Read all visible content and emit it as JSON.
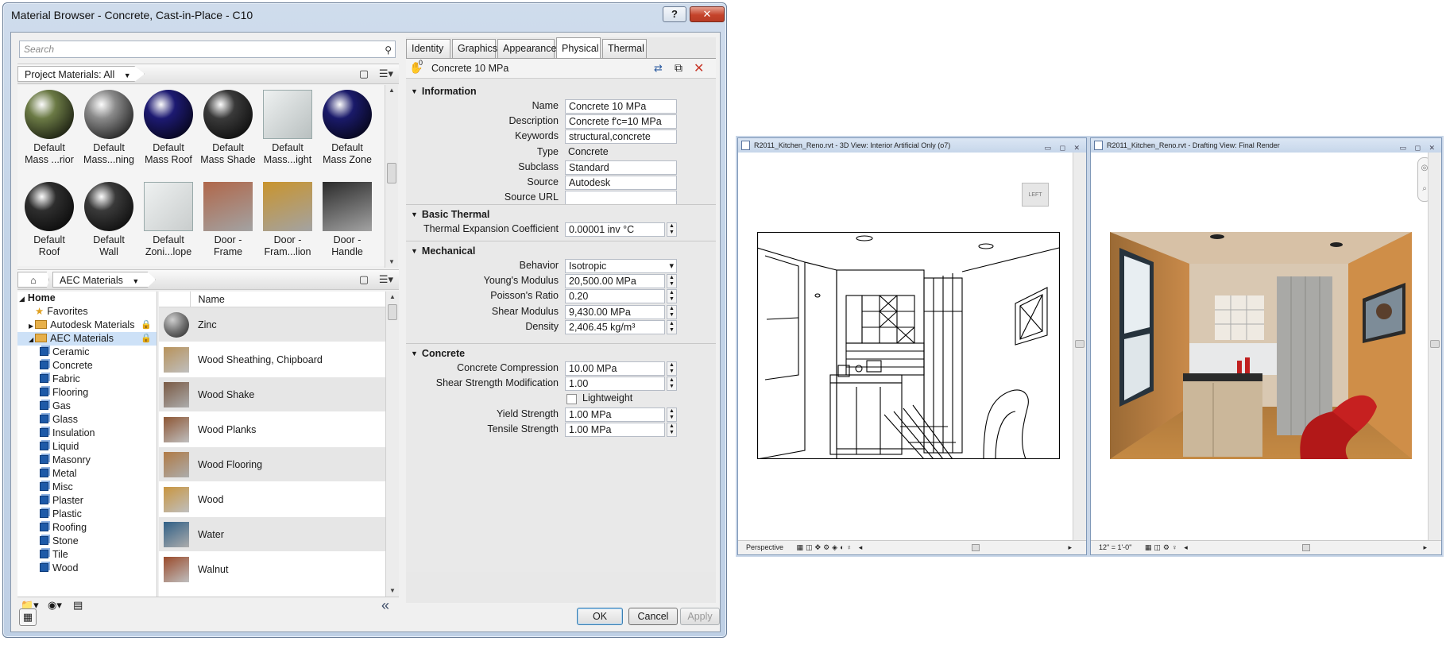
{
  "dialog": {
    "title": "Material Browser - Concrete, Cast-in-Place - C10",
    "help_label": "?",
    "close_label": "✕"
  },
  "browser": {
    "search_placeholder": "Search",
    "filter_label": "Project Materials: All",
    "swatches": [
      {
        "label1": "Default",
        "label2": "Mass ...rior",
        "color": "#6b7a45",
        "kind": "sphere"
      },
      {
        "label1": "Default",
        "label2": "Mass...ning",
        "color": "#8a8a8a",
        "kind": "sphere"
      },
      {
        "label1": "Default",
        "label2": "Mass Roof",
        "color": "#1d1a72",
        "kind": "sphere"
      },
      {
        "label1": "Default",
        "label2": "Mass Shade",
        "color": "#3a3a3a",
        "kind": "sphere"
      },
      {
        "label1": "Default",
        "label2": "Mass...ight",
        "color": "#b9c0c0",
        "kind": "glass"
      },
      {
        "label1": "Default",
        "label2": "Mass Zone",
        "color": "#1a1a6a",
        "kind": "sphere"
      },
      {
        "label1": "Default",
        "label2": "Roof",
        "color": "#2e2e2e",
        "kind": "sphere"
      },
      {
        "label1": "Default",
        "label2": "Wall",
        "color": "#3a3a3a",
        "kind": "sphere"
      },
      {
        "label1": "Default",
        "label2": "Zoni...lope",
        "color": "#c9cdcd",
        "kind": "glass"
      },
      {
        "label1": "Door -",
        "label2": "Frame",
        "color": "#b0674a",
        "kind": "box"
      },
      {
        "label1": "Door -",
        "label2": "Fram...lion",
        "color": "#c9942d",
        "kind": "box"
      },
      {
        "label1": "Door -",
        "label2": "Handle",
        "color": "#2b2b2b",
        "kind": "box"
      }
    ],
    "breadcrumb_library": "AEC Materials",
    "tree": [
      {
        "label": "Home",
        "level": 0,
        "kind": "root",
        "bold": true
      },
      {
        "label": "Favorites",
        "level": 1,
        "kind": "star"
      },
      {
        "label": "Autodesk Materials",
        "level": 1,
        "kind": "folder",
        "locked": true,
        "expander": "▶"
      },
      {
        "label": "AEC Materials",
        "level": 1,
        "kind": "folder",
        "locked": true,
        "expander": "◢",
        "selected": true
      },
      {
        "label": "Ceramic",
        "level": 2,
        "kind": "lib"
      },
      {
        "label": "Concrete",
        "level": 2,
        "kind": "lib"
      },
      {
        "label": "Fabric",
        "level": 2,
        "kind": "lib"
      },
      {
        "label": "Flooring",
        "level": 2,
        "kind": "lib"
      },
      {
        "label": "Gas",
        "level": 2,
        "kind": "lib"
      },
      {
        "label": "Glass",
        "level": 2,
        "kind": "lib"
      },
      {
        "label": "Insulation",
        "level": 2,
        "kind": "lib"
      },
      {
        "label": "Liquid",
        "level": 2,
        "kind": "lib"
      },
      {
        "label": "Masonry",
        "level": 2,
        "kind": "lib"
      },
      {
        "label": "Metal",
        "level": 2,
        "kind": "lib"
      },
      {
        "label": "Misc",
        "level": 2,
        "kind": "lib"
      },
      {
        "label": "Plaster",
        "level": 2,
        "kind": "lib"
      },
      {
        "label": "Plastic",
        "level": 2,
        "kind": "lib"
      },
      {
        "label": "Roofing",
        "level": 2,
        "kind": "lib"
      },
      {
        "label": "Stone",
        "level": 2,
        "kind": "lib"
      },
      {
        "label": "Tile",
        "level": 2,
        "kind": "lib"
      },
      {
        "label": "Wood",
        "level": 2,
        "kind": "lib"
      }
    ],
    "list_header": "Name",
    "materials": [
      {
        "name": "Zinc",
        "color": "#6f6f6f",
        "sphere": true
      },
      {
        "name": "Wood Sheathing, Chipboard",
        "color": "#b8925a"
      },
      {
        "name": "Wood Shake",
        "color": "#7a5a44"
      },
      {
        "name": "Wood Planks",
        "color": "#8d5634"
      },
      {
        "name": "Wood Flooring",
        "color": "#b07a45"
      },
      {
        "name": "Wood",
        "color": "#c9953f"
      },
      {
        "name": "Water",
        "color": "#2f5f86"
      },
      {
        "name": "Walnut",
        "color": "#9a4a2a"
      }
    ],
    "collapse_label": "«"
  },
  "editor": {
    "tabs": [
      "Identity",
      "Graphics",
      "Appearance",
      "Physical",
      "Thermal"
    ],
    "active_tab": "Physical",
    "asset_name": "Concrete 10 MPa",
    "asset_users": "0",
    "sections": {
      "information": {
        "title": "Information",
        "fields": [
          {
            "label": "Name",
            "value": "Concrete 10 MPa",
            "kind": "text"
          },
          {
            "label": "Description",
            "value": "Concrete f'c=10 MPa",
            "kind": "text"
          },
          {
            "label": "Keywords",
            "value": "structural,concrete",
            "kind": "text"
          },
          {
            "label": "Type",
            "value": "Concrete",
            "kind": "plain"
          },
          {
            "label": "Subclass",
            "value": "Standard",
            "kind": "text"
          },
          {
            "label": "Source",
            "value": "Autodesk",
            "kind": "text"
          },
          {
            "label": "Source URL",
            "value": "",
            "kind": "text"
          }
        ]
      },
      "basic_thermal": {
        "title": "Basic Thermal",
        "fields": [
          {
            "label": "Thermal Expansion Coefficient",
            "value": "0.00001 inv °C",
            "kind": "spin"
          }
        ]
      },
      "mechanical": {
        "title": "Mechanical",
        "fields": [
          {
            "label": "Behavior",
            "value": "Isotropic",
            "kind": "combo"
          },
          {
            "label": "Young's Modulus",
            "value": "20,500.00 MPa",
            "kind": "spin"
          },
          {
            "label": "Poisson's Ratio",
            "value": "0.20",
            "kind": "spin"
          },
          {
            "label": "Shear Modulus",
            "value": "9,430.00 MPa",
            "kind": "spin"
          },
          {
            "label": "Density",
            "value": "2,406.45 kg/m³",
            "kind": "spin"
          }
        ]
      },
      "concrete": {
        "title": "Concrete",
        "fields": [
          {
            "label": "Concrete Compression",
            "value": "10.00 MPa",
            "kind": "spin"
          },
          {
            "label": "Shear Strength Modification",
            "value": "1.00",
            "kind": "spin"
          },
          {
            "label": "",
            "value": "Lightweight",
            "kind": "check"
          },
          {
            "label": "Yield Strength",
            "value": "1.00 MPa",
            "kind": "spin"
          },
          {
            "label": "Tensile Strength",
            "value": "1.00 MPa",
            "kind": "spin"
          }
        ]
      }
    }
  },
  "buttons": {
    "ok": "OK",
    "cancel": "Cancel",
    "apply": "Apply"
  },
  "views": [
    {
      "title": "R2011_Kitchen_Reno.rvt - 3D View: Interior Artificial Only (o7)",
      "status": "Perspective",
      "cube_label": "LEFT"
    },
    {
      "title": "R2011_Kitchen_Reno.rvt - Drafting View: Final Render",
      "status": "12\" = 1'-0\""
    }
  ]
}
